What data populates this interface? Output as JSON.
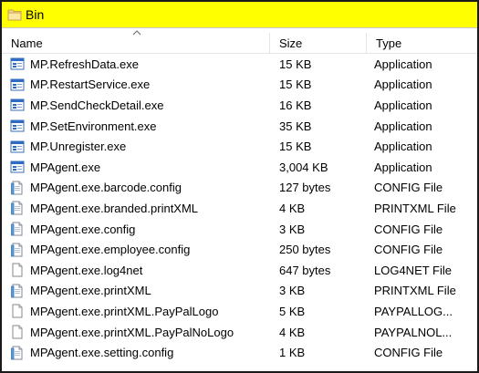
{
  "window": {
    "title": "Bin",
    "folder_icon": "folder-icon"
  },
  "columns": {
    "name": "Name",
    "size": "Size",
    "type": "Type"
  },
  "files": [
    {
      "name": "MP.RefreshData.exe",
      "size": "15 KB",
      "type": "Application",
      "icon": "application-icon"
    },
    {
      "name": "MP.RestartService.exe",
      "size": "15 KB",
      "type": "Application",
      "icon": "application-icon"
    },
    {
      "name": "MP.SendCheckDetail.exe",
      "size": "16 KB",
      "type": "Application",
      "icon": "application-icon"
    },
    {
      "name": "MP.SetEnvironment.exe",
      "size": "35 KB",
      "type": "Application",
      "icon": "application-icon"
    },
    {
      "name": "MP.Unregister.exe",
      "size": "15 KB",
      "type": "Application",
      "icon": "application-icon"
    },
    {
      "name": "MPAgent.exe",
      "size": "3,004 KB",
      "type": "Application",
      "icon": "application-icon"
    },
    {
      "name": "MPAgent.exe.barcode.config",
      "size": "127 bytes",
      "type": "CONFIG File",
      "icon": "config-file-icon"
    },
    {
      "name": "MPAgent.exe.branded.printXML",
      "size": "4 KB",
      "type": "PRINTXML File",
      "icon": "config-file-icon"
    },
    {
      "name": "MPAgent.exe.config",
      "size": "3 KB",
      "type": "CONFIG File",
      "icon": "config-file-icon"
    },
    {
      "name": "MPAgent.exe.employee.config",
      "size": "250 bytes",
      "type": "CONFIG File",
      "icon": "config-file-icon"
    },
    {
      "name": "MPAgent.exe.log4net",
      "size": "647 bytes",
      "type": "LOG4NET File",
      "icon": "blank-file-icon"
    },
    {
      "name": "MPAgent.exe.printXML",
      "size": "3 KB",
      "type": "PRINTXML File",
      "icon": "config-file-icon"
    },
    {
      "name": "MPAgent.exe.printXML.PayPalLogo",
      "size": "5 KB",
      "type": "PAYPALLOG...",
      "icon": "blank-file-icon"
    },
    {
      "name": "MPAgent.exe.printXML.PayPalNoLogo",
      "size": "4 KB",
      "type": "PAYPALNOL...",
      "icon": "blank-file-icon"
    },
    {
      "name": "MPAgent.exe.setting.config",
      "size": "1 KB",
      "type": "CONFIG File",
      "icon": "config-file-icon"
    }
  ]
}
